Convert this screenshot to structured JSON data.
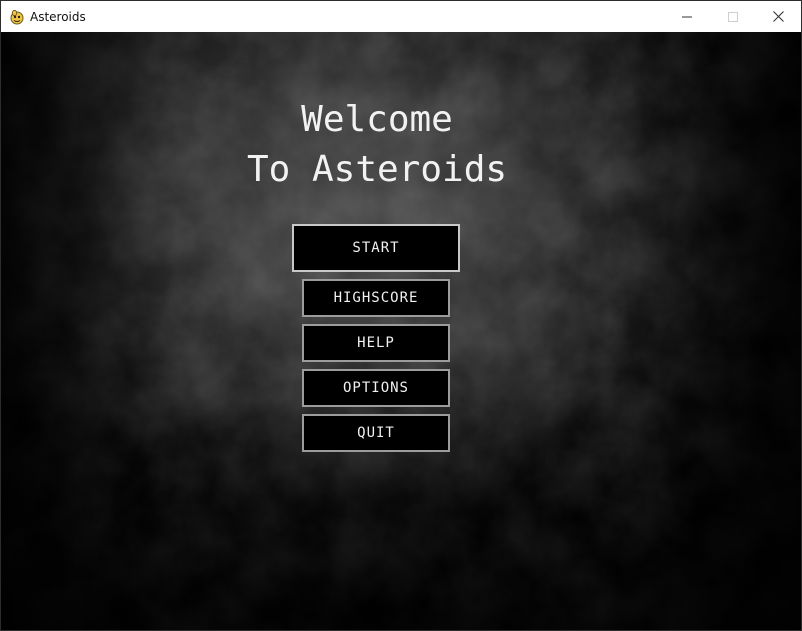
{
  "window": {
    "title": "Asteroids",
    "icon": "pygame-snake-icon",
    "controls": [
      "minimize-icon",
      "maximize-icon",
      "close-icon"
    ]
  },
  "game": {
    "heading_line1": "Welcome",
    "heading_line2": "To Asteroids",
    "menu": {
      "start": "START",
      "highscore": "HIGHSCORE",
      "help": "HELP",
      "options": "OPTIONS",
      "quit": "QUIT"
    }
  },
  "colors": {
    "background": "#000000",
    "text": "#f2f2f2",
    "button_border": "#9c9c9c",
    "titlebar": "#ffffff"
  }
}
